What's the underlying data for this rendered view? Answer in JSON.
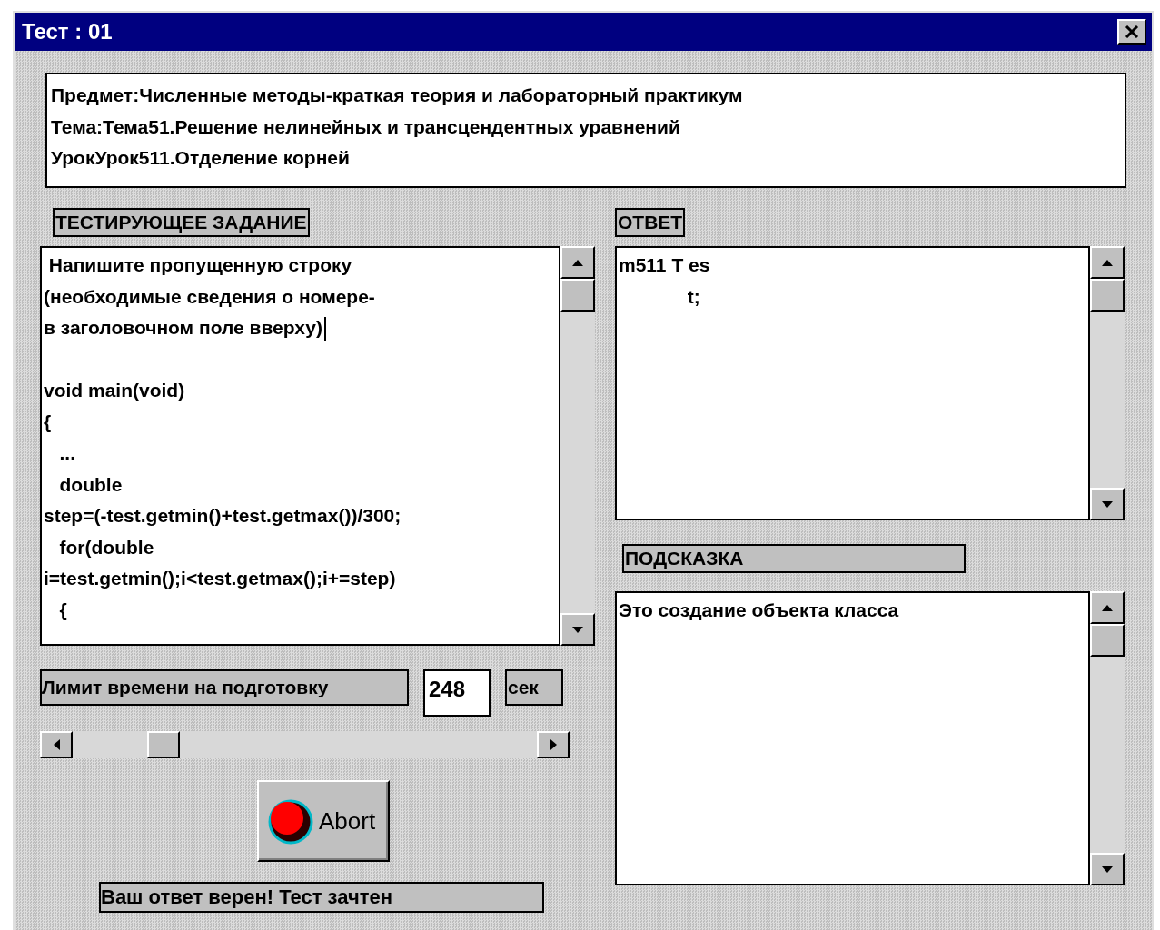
{
  "window": {
    "title": "Тест : 01"
  },
  "header": {
    "lines": [
      "Предмет:Численные методы-краткая теория и лабораторный практикум",
      "Тема:Тема51.Решение нелинейных и трансцендентных уравнений",
      "УрокУрок511.Отделение корней"
    ]
  },
  "task": {
    "label": "ТЕСТИРУЮЩЕЕ ЗАДАНИЕ",
    "intro": [
      " Напишите пропущенную строку",
      "(необходимые сведения о номере-",
      "в заголовочном поле вверху)"
    ],
    "code": [
      "void main(void)",
      "{",
      "   ...",
      "   double",
      "step=(-test.getmin()+test.getmax())/300;",
      "   for(double",
      "i=test.getmin();i<test.getmax();i+=step)",
      "   {"
    ]
  },
  "time_limit": {
    "label": "Лимит времени на подготовку",
    "value": "248",
    "unit": "сек"
  },
  "abort_button": {
    "label": "Abort"
  },
  "status": "Ваш ответ верен! Тест зачтен",
  "answer": {
    "label": "ОТВЕТ",
    "lines": [
      "m511 T es",
      "             t;"
    ]
  },
  "hint": {
    "label": "ПОДСКАЗКА",
    "text": "Это создание объекта класса"
  }
}
